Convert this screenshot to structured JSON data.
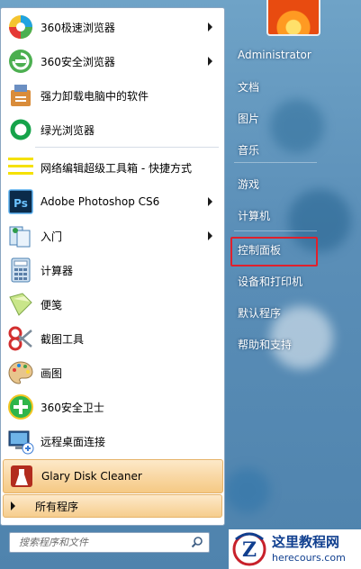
{
  "left_items": [
    {
      "key": "360-speed-browser",
      "label": "360极速浏览器",
      "icon": "360-speed-browser-icon",
      "has_arrow": true
    },
    {
      "key": "360-safe-browser",
      "label": "360安全浏览器",
      "icon": "360-safe-browser-icon",
      "has_arrow": true
    },
    {
      "key": "uninstall-software",
      "label": "强力卸载电脑中的软件",
      "icon": "uninstaller-icon",
      "has_arrow": false
    },
    {
      "key": "green-browser",
      "label": "绿光浏览器",
      "icon": "green-browser-icon",
      "has_arrow": false
    },
    {
      "key": "network-editor",
      "label": "网络编辑超级工具箱 - 快捷方式",
      "icon": "toolbox-shortcut-icon",
      "has_arrow": false
    },
    {
      "key": "photoshop",
      "label": "Adobe Photoshop CS6",
      "icon": "photoshop-icon",
      "has_arrow": true
    },
    {
      "key": "getting-started",
      "label": "入门",
      "icon": "getting-started-icon",
      "has_arrow": true
    },
    {
      "key": "calculator",
      "label": "计算器",
      "icon": "calculator-icon",
      "has_arrow": false
    },
    {
      "key": "sticky-notes",
      "label": "便笺",
      "icon": "sticky-notes-icon",
      "has_arrow": false
    },
    {
      "key": "snipping-tool",
      "label": "截图工具",
      "icon": "scissors-icon",
      "has_arrow": false
    },
    {
      "key": "paint",
      "label": "画图",
      "icon": "paint-palette-icon",
      "has_arrow": false
    },
    {
      "key": "360-guard",
      "label": "360安全卫士",
      "icon": "360-guard-icon",
      "has_arrow": false
    },
    {
      "key": "remote-desktop",
      "label": "远程桌面连接",
      "icon": "remote-desktop-icon",
      "has_arrow": false
    },
    {
      "key": "glary-disk-cleaner",
      "label": "Glary Disk Cleaner",
      "icon": "disk-cleaner-icon",
      "has_arrow": false
    }
  ],
  "all_programs_label": "所有程序",
  "search": {
    "placeholder": "搜索程序和文件"
  },
  "right_items": [
    {
      "key": "administrator",
      "label": "Administrator"
    },
    {
      "key": "documents",
      "label": "文档"
    },
    {
      "key": "pictures",
      "label": "图片"
    },
    {
      "key": "music",
      "label": "音乐"
    },
    {
      "key": "games",
      "label": "游戏"
    },
    {
      "key": "computer",
      "label": "计算机"
    },
    {
      "key": "control-panel",
      "label": "控制面板"
    },
    {
      "key": "devices-printers",
      "label": "设备和打印机"
    },
    {
      "key": "default-programs",
      "label": "默认程序"
    },
    {
      "key": "help-support",
      "label": "帮助和支持"
    }
  ],
  "watermark": {
    "cn": "这里教程网",
    "en": "herecours.com"
  },
  "colors": {
    "highlight": "#f9d8a5",
    "selection_box": "#e0202c",
    "brand_blue": "#103f8f"
  }
}
